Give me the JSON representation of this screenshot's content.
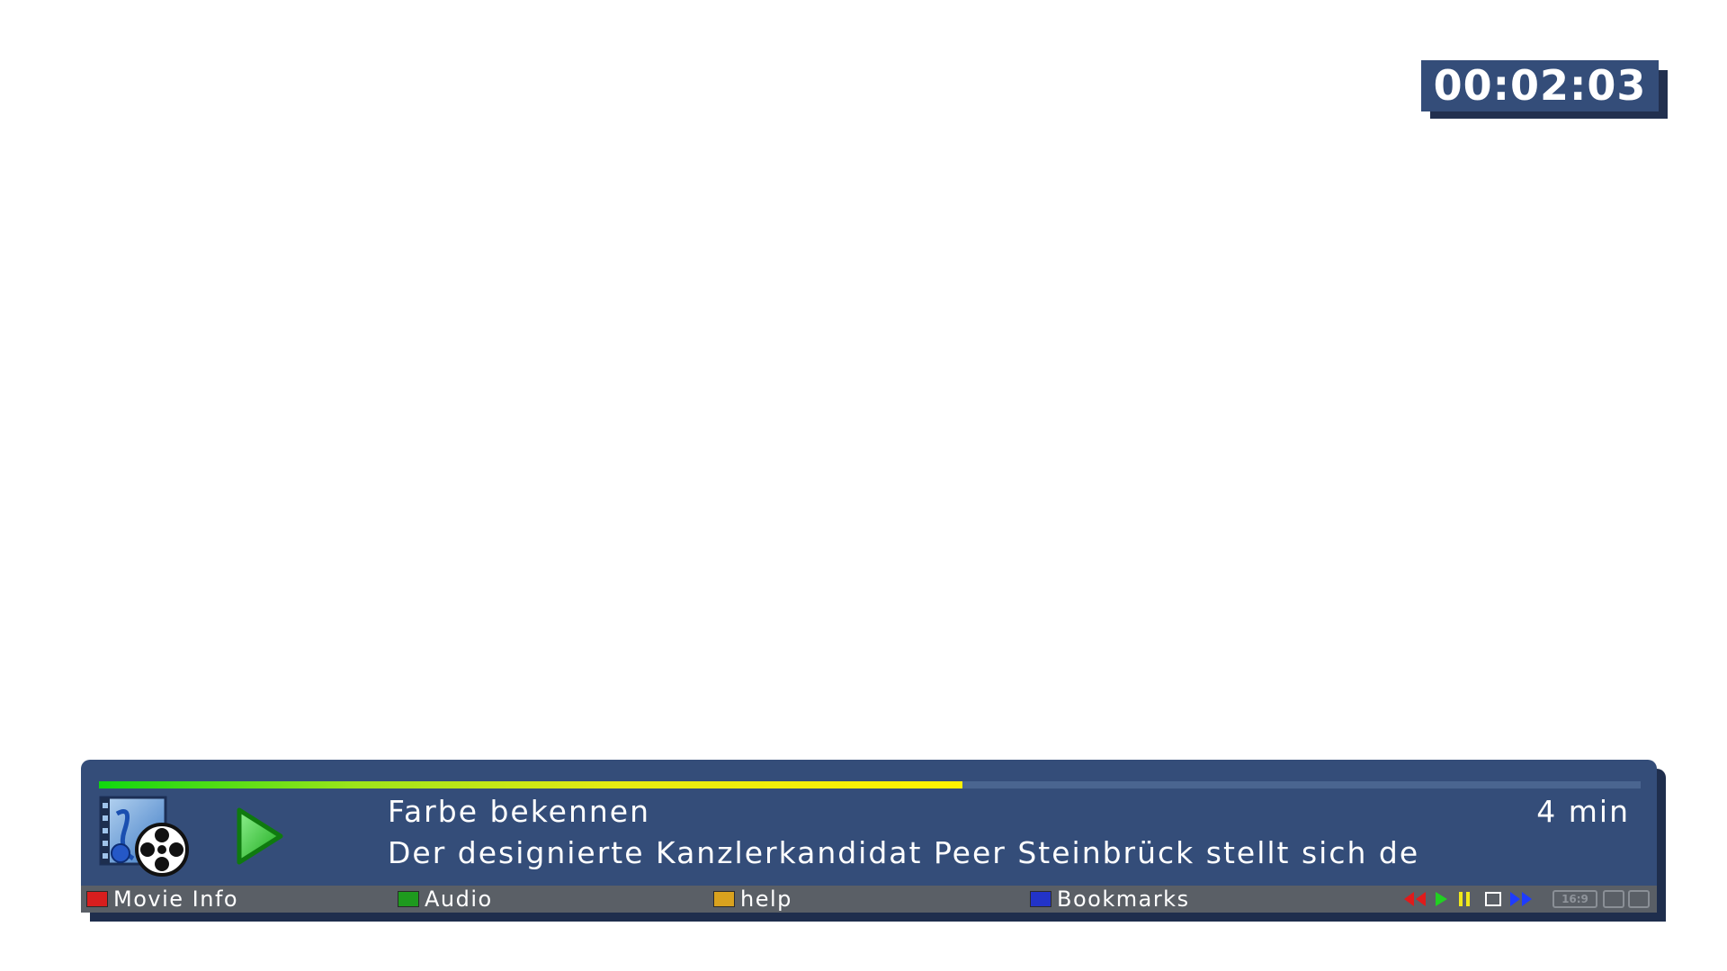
{
  "clock": {
    "time": "00:02:03"
  },
  "info": {
    "title": "Farbe bekennen",
    "duration": "4 min",
    "description": "Der designierte Kanzlerkandidat Peer Steinbrück stellt sich de",
    "progress_fraction": 0.56,
    "play_state_icon": "play-icon"
  },
  "buttons": {
    "red": {
      "label": "Movie Info",
      "color": "#d81e1e"
    },
    "green": {
      "label": "Audio",
      "color": "#1e9a1e"
    },
    "yellow": {
      "label": "help",
      "color": "#d9a21e"
    },
    "blue": {
      "label": "Bookmarks",
      "color": "#2233c8"
    }
  },
  "transport": {
    "icons": [
      "rewind-icon",
      "play-icon",
      "pause-icon",
      "stop-icon",
      "fast-forward-icon"
    ],
    "aspect_ratio": "16:9",
    "colors": {
      "rewind": "#e01b1b",
      "play": "#22d022",
      "pause": "#f0e81a",
      "stop": "#ffffff",
      "fast_forward": "#1e3cff"
    }
  },
  "colors": {
    "panel": "#344d79",
    "panel_shadow": "#1f2e4d",
    "button_row": "#5a5f66",
    "progress_start": "#10d810",
    "progress_end": "#fff200"
  }
}
